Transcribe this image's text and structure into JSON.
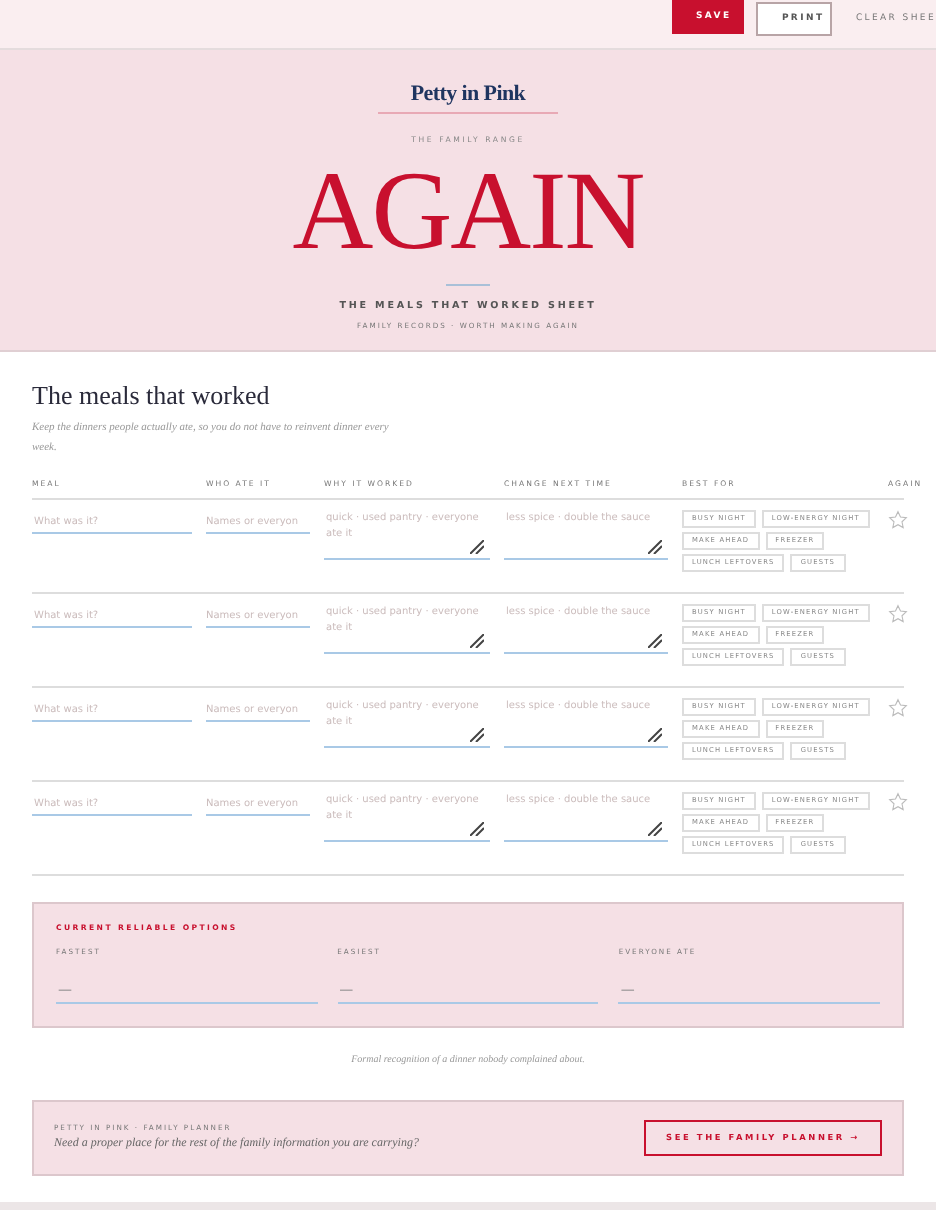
{
  "toolbar": {
    "buttons": [
      {
        "label": "SAVE",
        "kind": "primary"
      },
      {
        "label": "PRINT",
        "kind": "outline"
      },
      {
        "label": "CLEAR SHEE",
        "kind": "text"
      }
    ]
  },
  "hero": {
    "brand": "Petty in Pink",
    "kicker": "THE FAMILY RANGE",
    "title": "AGAIN",
    "subtitle": "THE MEALS THAT WORKED SHEET",
    "tagline": "FAMILY RECORDS · WORTH MAKING AGAIN"
  },
  "section": {
    "title": "The meals that worked",
    "intro": "Keep the dinners people actually ate, so you do not have to reinvent dinner every week."
  },
  "table": {
    "columns": [
      "MEAL",
      "WHO ATE IT",
      "WHY IT WORKED",
      "CHANGE NEXT TIME",
      "BEST FOR",
      "AGAIN"
    ],
    "rows": [
      {
        "meal_placeholder": "What was it?",
        "who_placeholder": "Names or everyon",
        "why_placeholder": "quick · used pantry · everyone ate it",
        "change_placeholder": "less spice · double the sauce",
        "starred": false,
        "tags": [
          {
            "label": "BUSY NIGHT",
            "selected": false
          },
          {
            "label": "LOW-ENERGY NIGHT",
            "selected": false
          },
          {
            "label": "MAKE AHEAD",
            "selected": false
          },
          {
            "label": "FREEZER",
            "selected": false
          },
          {
            "label": "LUNCH LEFTOVERS",
            "selected": false
          },
          {
            "label": "GUESTS",
            "selected": false
          }
        ]
      },
      {
        "meal_placeholder": "What was it?",
        "who_placeholder": "Names or everyon",
        "why_placeholder": "quick · used pantry · everyone ate it",
        "change_placeholder": "less spice · double the sauce",
        "starred": false,
        "tags": [
          {
            "label": "BUSY NIGHT",
            "selected": false
          },
          {
            "label": "LOW-ENERGY NIGHT",
            "selected": false
          },
          {
            "label": "MAKE AHEAD",
            "selected": false
          },
          {
            "label": "FREEZER",
            "selected": false
          },
          {
            "label": "LUNCH LEFTOVERS",
            "selected": false
          },
          {
            "label": "GUESTS",
            "selected": false
          }
        ]
      },
      {
        "meal_placeholder": "What was it?",
        "who_placeholder": "Names or everyon",
        "why_placeholder": "quick · used pantry · everyone ate it",
        "change_placeholder": "less spice · double the sauce",
        "starred": false,
        "tags": [
          {
            "label": "BUSY NIGHT",
            "selected": false
          },
          {
            "label": "LOW-ENERGY NIGHT",
            "selected": false
          },
          {
            "label": "MAKE AHEAD",
            "selected": false
          },
          {
            "label": "FREEZER",
            "selected": false
          },
          {
            "label": "LUNCH LEFTOVERS",
            "selected": false
          },
          {
            "label": "GUESTS",
            "selected": false
          }
        ]
      },
      {
        "meal_placeholder": "What was it?",
        "who_placeholder": "Names or everyon",
        "why_placeholder": "quick · used pantry · everyone ate it",
        "change_placeholder": "less spice · double the sauce",
        "starred": false,
        "tags": [
          {
            "label": "BUSY NIGHT",
            "selected": false
          },
          {
            "label": "LOW-ENERGY NIGHT",
            "selected": false
          },
          {
            "label": "MAKE AHEAD",
            "selected": false
          },
          {
            "label": "FREEZER",
            "selected": false
          },
          {
            "label": "LUNCH LEFTOVERS",
            "selected": false
          },
          {
            "label": "GUESTS",
            "selected": false
          }
        ]
      }
    ]
  },
  "summary": {
    "title": "CURRENT RELIABLE OPTIONS",
    "fields": [
      {
        "label": "FASTEST",
        "placeholder": "—"
      },
      {
        "label": "EASIEST",
        "placeholder": "—"
      },
      {
        "label": "EVERYONE ATE",
        "placeholder": "—"
      }
    ]
  },
  "footnote": "Formal recognition of a dinner nobody complained about.",
  "promo": {
    "kicker": "PETTY IN PINK · FAMILY PLANNER",
    "text": "Need a proper place for the rest of the family information you are carrying?",
    "button": "SEE THE FAMILY PLANNER →"
  }
}
